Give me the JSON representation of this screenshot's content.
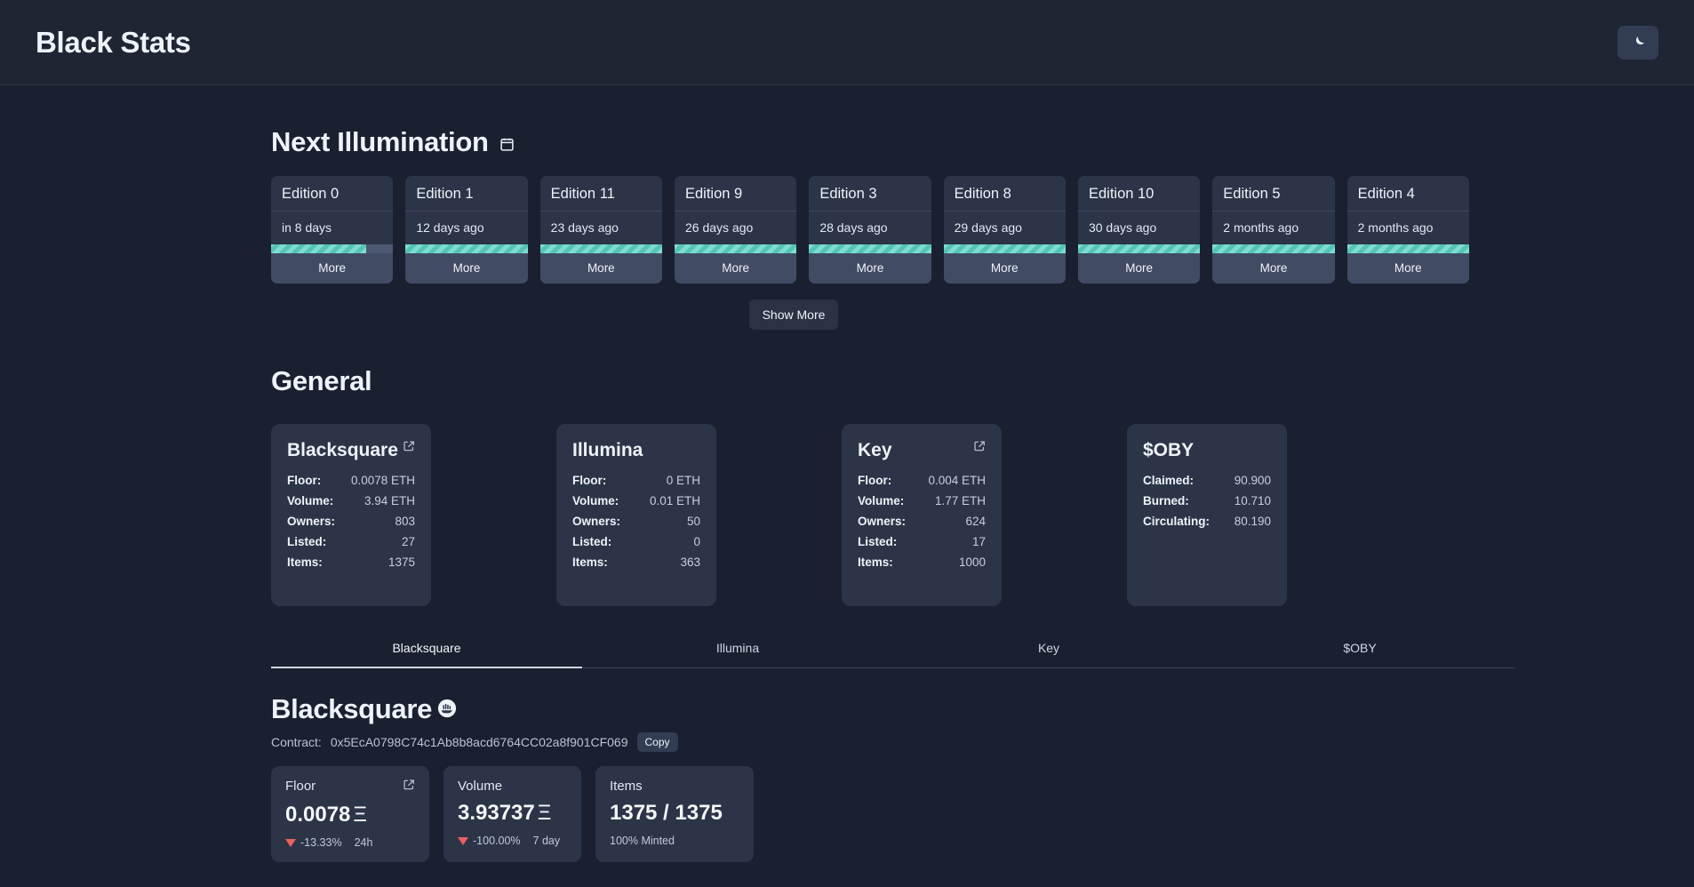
{
  "header": {
    "title": "Black Stats",
    "theme_toggle_icon": "moon-icon"
  },
  "next_illumination": {
    "heading": "Next Illumination",
    "heading_icon": "calendar-icon",
    "show_more_label": "Show More",
    "more_label": "More",
    "editions": [
      {
        "title": "Edition 0",
        "when": "in 8 days",
        "progress": 78
      },
      {
        "title": "Edition 1",
        "when": "12 days ago",
        "progress": 100
      },
      {
        "title": "Edition 11",
        "when": "23 days ago",
        "progress": 100
      },
      {
        "title": "Edition 9",
        "when": "26 days ago",
        "progress": 100
      },
      {
        "title": "Edition 3",
        "when": "28 days ago",
        "progress": 100
      },
      {
        "title": "Edition 8",
        "when": "29 days ago",
        "progress": 100
      },
      {
        "title": "Edition 10",
        "when": "30 days ago",
        "progress": 100
      },
      {
        "title": "Edition 5",
        "when": "2 months ago",
        "progress": 100
      },
      {
        "title": "Edition 4",
        "when": "2 months ago",
        "progress": 100
      }
    ]
  },
  "general": {
    "heading": "General",
    "cards": [
      {
        "title": "Blacksquare",
        "has_link": true,
        "link_icon": "external-link-icon",
        "rows": [
          {
            "label": "Floor:",
            "value": "0.0078 ETH"
          },
          {
            "label": "Volume:",
            "value": "3.94 ETH"
          },
          {
            "label": "Owners:",
            "value": "803"
          },
          {
            "label": "Listed:",
            "value": "27"
          },
          {
            "label": "Items:",
            "value": "1375"
          }
        ]
      },
      {
        "title": "Illumina",
        "has_link": false,
        "rows": [
          {
            "label": "Floor:",
            "value": "0 ETH"
          },
          {
            "label": "Volume:",
            "value": "0.01 ETH"
          },
          {
            "label": "Owners:",
            "value": "50"
          },
          {
            "label": "Listed:",
            "value": "0"
          },
          {
            "label": "Items:",
            "value": "363"
          }
        ]
      },
      {
        "title": "Key",
        "has_link": true,
        "link_icon": "external-link-icon",
        "rows": [
          {
            "label": "Floor:",
            "value": "0.004 ETH"
          },
          {
            "label": "Volume:",
            "value": "1.77 ETH"
          },
          {
            "label": "Owners:",
            "value": "624"
          },
          {
            "label": "Listed:",
            "value": "17"
          },
          {
            "label": "Items:",
            "value": "1000"
          }
        ]
      },
      {
        "title": "$OBY",
        "has_link": false,
        "rows": [
          {
            "label": "Claimed:",
            "value": "90.900"
          },
          {
            "label": "Burned:",
            "value": "10.710"
          },
          {
            "label": "Circulating:",
            "value": "80.190"
          }
        ]
      }
    ]
  },
  "tabs": [
    {
      "label": "Blacksquare",
      "active": true
    },
    {
      "label": "Illumina",
      "active": false
    },
    {
      "label": "Key",
      "active": false
    },
    {
      "label": "$OBY",
      "active": false
    }
  ],
  "collection": {
    "title": "Blacksquare",
    "title_icon": "opensea-icon",
    "contract_label": "Contract:",
    "contract_address": "0x5EcA0798C74c1Ab8b8acd6764CC02a8f901CF069",
    "copy_label": "Copy",
    "stats": {
      "floor": {
        "label": "Floor",
        "value": "0.0078",
        "unit": "Ξ",
        "link_icon": "external-link-icon",
        "change": "-13.33%",
        "change_direction": "down",
        "period": "24h"
      },
      "volume": {
        "label": "Volume",
        "value": "3.93737",
        "unit": "Ξ",
        "change": "-100.00%",
        "change_direction": "down",
        "period": "7 day"
      },
      "items": {
        "label": "Items",
        "value": "1375 / 1375",
        "minted": "100% Minted"
      }
    }
  },
  "colors": {
    "page_bg": "#1a2030",
    "header_bg": "#1e2533",
    "card_bg": "#2c3447",
    "accent_teal": "#7fdcd0",
    "negative_red": "#e8625c"
  }
}
